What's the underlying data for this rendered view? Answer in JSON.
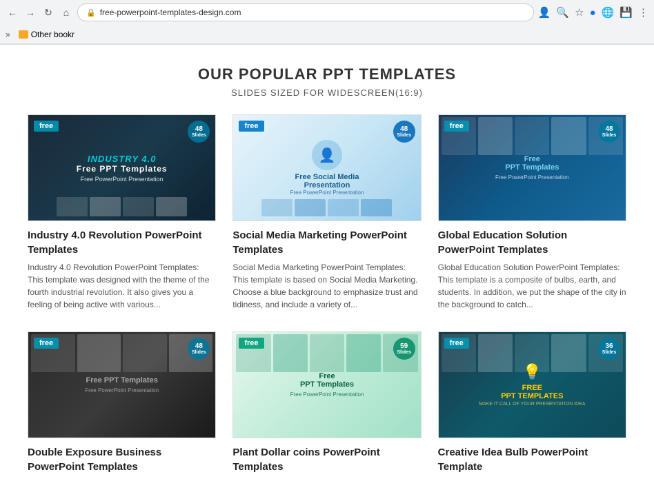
{
  "browser": {
    "url": "free-powerpoint-templates-design.com",
    "bookmarks_label": "Other bookr"
  },
  "page": {
    "title": "OUR POPULAR PPT TEMPLATES",
    "subtitle": "SLIDES SIZED FOR WIDESCREEN(16:9)"
  },
  "cards": [
    {
      "id": "industry40",
      "title": "Industry 4.0 Revolution PowerPoint Templates",
      "description": "Industry 4.0 Revolution PowerPoint Templates: This template was designed with the theme of the fourth industrial revolution. It also gives you a feeling of being active with various...",
      "free_label": "free",
      "slides": "48",
      "slides_unit": "Slides",
      "theme": "industry40"
    },
    {
      "id": "social-media",
      "title": "Social Media Marketing PowerPoint Templates",
      "description": "Social Media Marketing PowerPoint Templates: This template is based on Social Media Marketing. Choose a blue background to emphasize trust and tidiness, and include a variety of...",
      "free_label": "free",
      "slides": "48",
      "slides_unit": "Slides",
      "theme": "social-media"
    },
    {
      "id": "global-edu",
      "title": "Global Education Solution PowerPoint Templates",
      "description": "Global Education Solution PowerPoint Templates: This template is a composite of bulbs, earth, and students. In addition, we put the shape of the city in the background to catch...",
      "free_label": "free",
      "slides": "48",
      "slides_unit": "Slides",
      "theme": "global-edu"
    },
    {
      "id": "double-exposure",
      "title": "Double Exposure Business PowerPoint Templates",
      "description": "",
      "free_label": "free",
      "slides": "48",
      "slides_unit": "Slides",
      "theme": "double-exposure"
    },
    {
      "id": "plant-dollar",
      "title": "Plant Dollar coins PowerPoint Templates",
      "description": "",
      "free_label": "free",
      "slides": "59",
      "slides_unit": "Slides",
      "theme": "plant-dollar"
    },
    {
      "id": "creative-bulb",
      "title": "Creative Idea Bulb PowerPoint Template",
      "description": "",
      "free_label": "free",
      "slides": "36",
      "slides_unit": "Slides",
      "theme": "creative-bulb"
    }
  ]
}
